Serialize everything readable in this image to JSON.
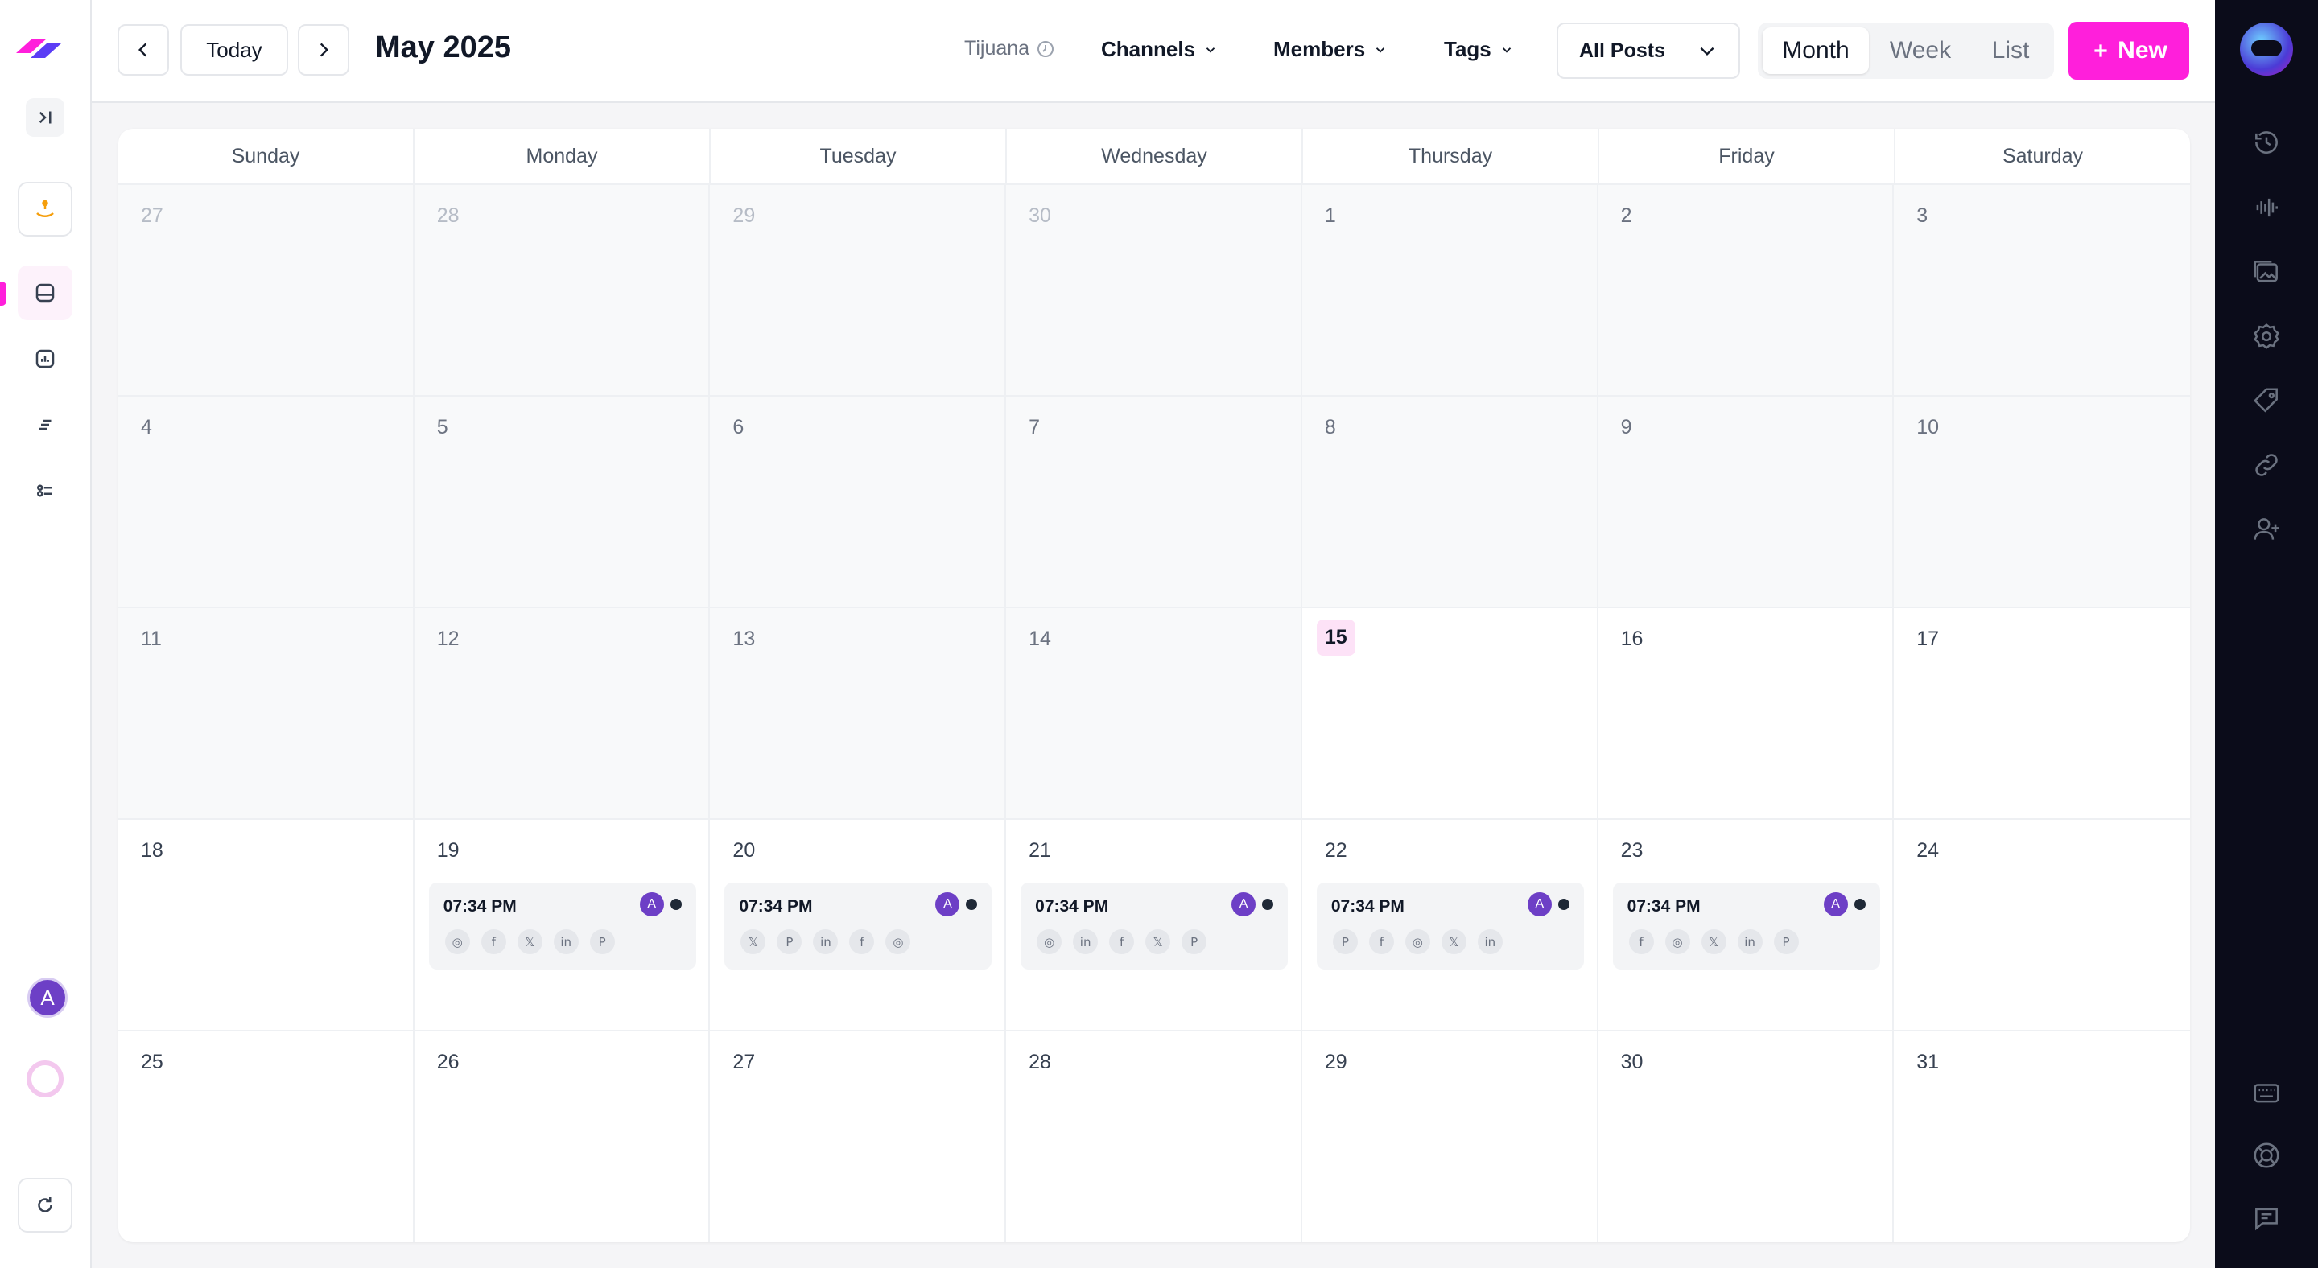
{
  "header": {
    "today_label": "Today",
    "month_title": "May 2025",
    "timezone": "Tijuana",
    "filters": [
      "Channels",
      "Members",
      "Tags"
    ],
    "posts_select": "All Posts",
    "views": [
      "Month",
      "Week",
      "List"
    ],
    "selected_view": "Month",
    "new_label": "New"
  },
  "calendar": {
    "weekdays": [
      "Sunday",
      "Monday",
      "Tuesday",
      "Wednesday",
      "Thursday",
      "Friday",
      "Saturday"
    ],
    "weeks": [
      [
        "27",
        "28",
        "29",
        "30",
        "1",
        "2",
        "3"
      ],
      [
        "4",
        "5",
        "6",
        "7",
        "8",
        "9",
        "10"
      ],
      [
        "11",
        "12",
        "13",
        "14",
        "15",
        "16",
        "17"
      ],
      [
        "18",
        "19",
        "20",
        "21",
        "22",
        "23",
        "24"
      ],
      [
        "25",
        "26",
        "27",
        "28",
        "29",
        "30",
        "31"
      ]
    ],
    "today": "15",
    "events": [
      {
        "day": "19",
        "time": "07:34 PM",
        "avatar": "A",
        "channels": [
          "instagram",
          "facebook",
          "x",
          "linkedin",
          "pinterest"
        ]
      },
      {
        "day": "20",
        "time": "07:34 PM",
        "avatar": "A",
        "channels": [
          "x",
          "pinterest",
          "linkedin",
          "facebook",
          "instagram"
        ]
      },
      {
        "day": "21",
        "time": "07:34 PM",
        "avatar": "A",
        "channels": [
          "instagram",
          "linkedin",
          "facebook",
          "x",
          "pinterest"
        ]
      },
      {
        "day": "22",
        "time": "07:34 PM",
        "avatar": "A",
        "channels": [
          "pinterest",
          "facebook",
          "instagram",
          "x",
          "linkedin"
        ]
      },
      {
        "day": "23",
        "time": "07:34 PM",
        "avatar": "A",
        "channels": [
          "facebook",
          "instagram",
          "x",
          "linkedin",
          "pinterest"
        ]
      }
    ]
  },
  "left_sidebar": {
    "user_initial": "A",
    "icons": [
      "sidebar-expand-icon",
      "launch-icon",
      "calendar-icon",
      "analytics-icon",
      "filter-list-icon",
      "settings-sliders-icon",
      "refresh-icon"
    ]
  },
  "right_sidebar": {
    "icons": [
      "history-icon",
      "audio-wave-icon",
      "media-library-icon",
      "badge-icon",
      "tag-icon",
      "link-icon",
      "add-user-icon",
      "keyboard-icon",
      "help-icon",
      "chat-icon"
    ]
  },
  "colors": {
    "accent": "#ff1fdb",
    "avatar": "#6d3fc6",
    "right_sidebar_bg": "#0b0c1a"
  }
}
